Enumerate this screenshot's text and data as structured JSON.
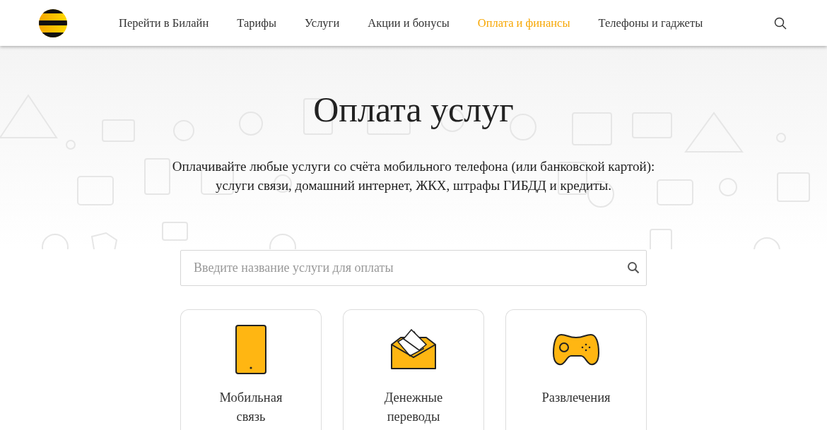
{
  "header": {
    "nav": [
      {
        "label": "Перейти в Билайн",
        "selected": false
      },
      {
        "label": "Тарифы",
        "selected": false
      },
      {
        "label": "Услуги",
        "selected": false
      },
      {
        "label": "Акции и бонусы",
        "selected": false
      },
      {
        "label": "Оплата и финансы",
        "selected": true
      },
      {
        "label": "Телефоны и гаджеты",
        "selected": false
      }
    ]
  },
  "hero": {
    "title": "Оплата услуг",
    "description": [
      "Оплачивайте любые услуги со счёта мобильного телефона (или банковской картой):",
      "услуги связи, домашний интернет, ЖКХ, штрафы ГИБДД и кредиты."
    ]
  },
  "search": {
    "placeholder": "Введите название услуги для оплаты"
  },
  "categories": [
    {
      "label": [
        "Мобильная",
        "связь"
      ]
    },
    {
      "label": [
        "Денежные",
        "переводы"
      ]
    },
    {
      "label": [
        "Развлечения"
      ]
    }
  ]
}
